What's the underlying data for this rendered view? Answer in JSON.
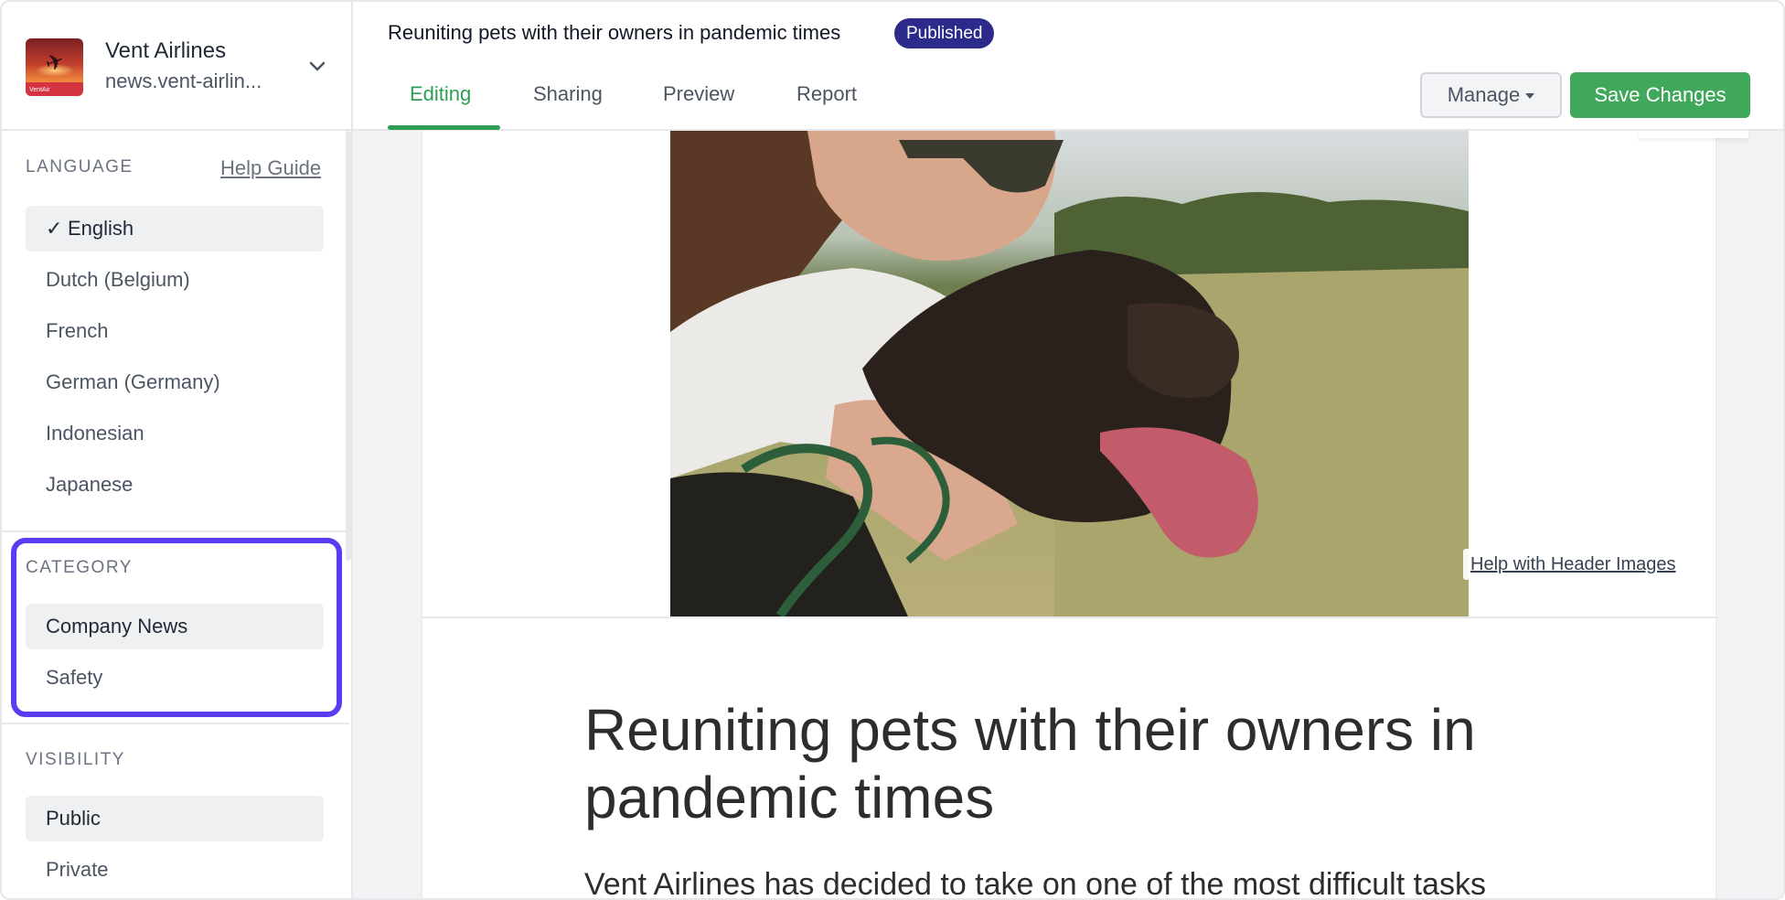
{
  "org": {
    "name": "Vent Airlines",
    "domain": "news.vent-airlin...",
    "logo_text": "VentAir"
  },
  "sidebar": {
    "help_guide": "Help Guide",
    "language": {
      "label": "LANGUAGE",
      "items": [
        {
          "label": "English",
          "selected": true
        },
        {
          "label": "Dutch (Belgium)",
          "selected": false
        },
        {
          "label": "French",
          "selected": false
        },
        {
          "label": "German (Germany)",
          "selected": false
        },
        {
          "label": "Indonesian",
          "selected": false
        },
        {
          "label": "Japanese",
          "selected": false
        }
      ]
    },
    "category": {
      "label": "CATEGORY",
      "items": [
        {
          "label": "Company News",
          "selected": true
        },
        {
          "label": "Safety",
          "selected": false
        }
      ]
    },
    "visibility": {
      "label": "VISIBILITY",
      "items": [
        {
          "label": "Public",
          "selected": true
        },
        {
          "label": "Private",
          "selected": false
        }
      ]
    }
  },
  "header": {
    "title": "Reuniting pets with their owners in pandemic times",
    "status_badge": "Published",
    "tabs": [
      {
        "label": "Editing",
        "active": true
      },
      {
        "label": "Sharing",
        "active": false
      },
      {
        "label": "Preview",
        "active": false
      },
      {
        "label": "Report",
        "active": false
      }
    ],
    "manage_label": "Manage",
    "save_label": "Save Changes"
  },
  "article": {
    "help_header_images": "Help with Header Images",
    "title": "Reuniting pets with their owners in pandemic times",
    "body_start": "Vent Airlines has decided to take on one of the most difficult tasks"
  },
  "colors": {
    "accent_green": "#3fa85b",
    "badge_navy": "#2c2a8a",
    "highlight_purple": "#5a3df2"
  }
}
